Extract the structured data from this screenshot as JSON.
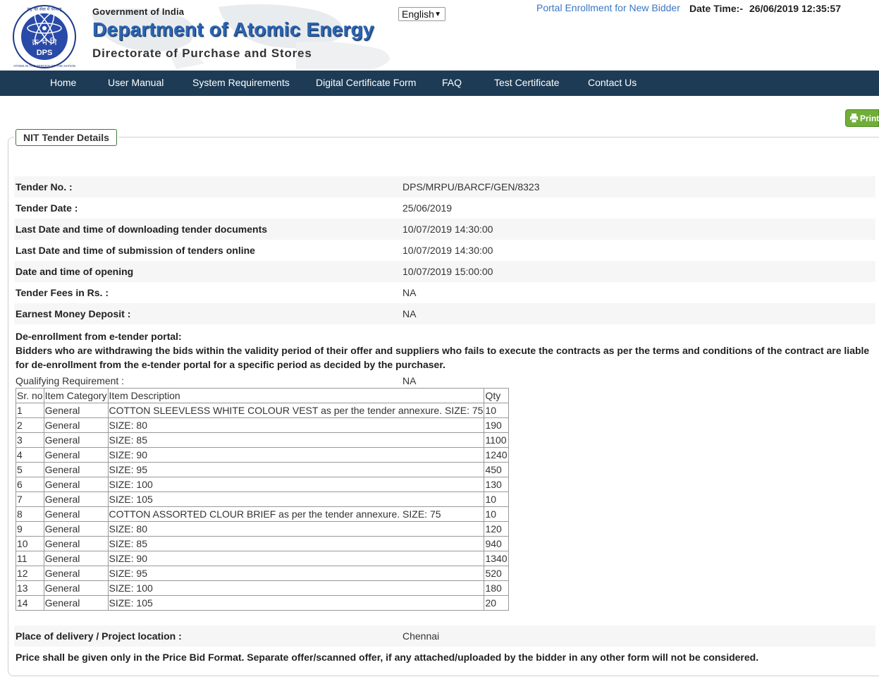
{
  "header": {
    "logo_lines": [
      "राष्ट्र की सेवा में परमाणु",
      "क्र भं नि",
      "DPS",
      "ATOMS IN THE SERVICE OF THE NATION"
    ],
    "gov_text": "Government of India",
    "dept_title": "Department of Atomic Energy",
    "directorate": "Directorate of Purchase and Stores",
    "language": "English",
    "portal_link": "Portal Enrollment for New Bidder",
    "date_label": "Date Time:-",
    "date_value": "26/06/2019 12:35:57"
  },
  "nav": [
    "Home",
    "User Manual",
    "System Requirements",
    "Digital Certificate Form",
    "FAQ",
    "Test Certificate",
    "Contact Us"
  ],
  "print_label": "Print",
  "panel_title": "NIT Tender Details",
  "details": [
    {
      "label": "Tender No. :",
      "value": "DPS/MRPU/BARCF/GEN/8323"
    },
    {
      "label": "Tender Date :",
      "value": "25/06/2019"
    },
    {
      "label": "Last Date and time of downloading tender documents",
      "value": "10/07/2019 14:30:00"
    },
    {
      "label": "Last Date and time of submission of tenders online",
      "value": "10/07/2019 14:30:00"
    },
    {
      "label": "Date and time of opening",
      "value": "10/07/2019 15:00:00"
    },
    {
      "label": "Tender Fees in Rs. :",
      "value": "NA"
    },
    {
      "label": "Earnest Money Deposit :",
      "value": "NA"
    }
  ],
  "deenroll": {
    "title": "De-enrollment from e-tender portal:",
    "text": "Bidders who are withdrawing the bids within the validity period of their offer and suppliers who fails to execute the contracts as per the terms and conditions of the contract are liable for de-enrollment from the e-tender portal for a specific period as decided by the purchaser."
  },
  "qualifying": {
    "label": "Qualifying Requirement :",
    "value": "NA"
  },
  "items_table": {
    "headers": [
      "Sr. no",
      "Item Category",
      "Item Description",
      "Qty"
    ],
    "rows": [
      [
        "1",
        "General",
        "COTTON SLEEVLESS WHITE COLOUR VEST as per the tender annexure. SIZE: 75",
        "10"
      ],
      [
        "2",
        "General",
        "SIZE: 80",
        "190"
      ],
      [
        "3",
        "General",
        "SIZE: 85",
        "1100"
      ],
      [
        "4",
        "General",
        "SIZE: 90",
        "1240"
      ],
      [
        "5",
        "General",
        "SIZE: 95",
        "450"
      ],
      [
        "6",
        "General",
        "SIZE: 100",
        "130"
      ],
      [
        "7",
        "General",
        "SIZE: 105",
        "10"
      ],
      [
        "8",
        "General",
        "COTTON ASSORTED CLOUR BRIEF as per the tender annexure. SIZE: 75",
        "10"
      ],
      [
        "9",
        "General",
        "SIZE: 80",
        "120"
      ],
      [
        "10",
        "General",
        "SIZE: 85",
        "940"
      ],
      [
        "11",
        "General",
        "SIZE: 90",
        "1340"
      ],
      [
        "12",
        "General",
        "SIZE: 95",
        "520"
      ],
      [
        "13",
        "General",
        "SIZE: 100",
        "180"
      ],
      [
        "14",
        "General",
        "SIZE: 105",
        "20"
      ]
    ]
  },
  "place": {
    "label": "Place of delivery / Project location :",
    "value": "Chennai"
  },
  "price_note": "Price shall be given only in the Price Bid Format. Separate offer/scanned offer, if any attached/uploaded by the bidder in any other form will not be considered."
}
